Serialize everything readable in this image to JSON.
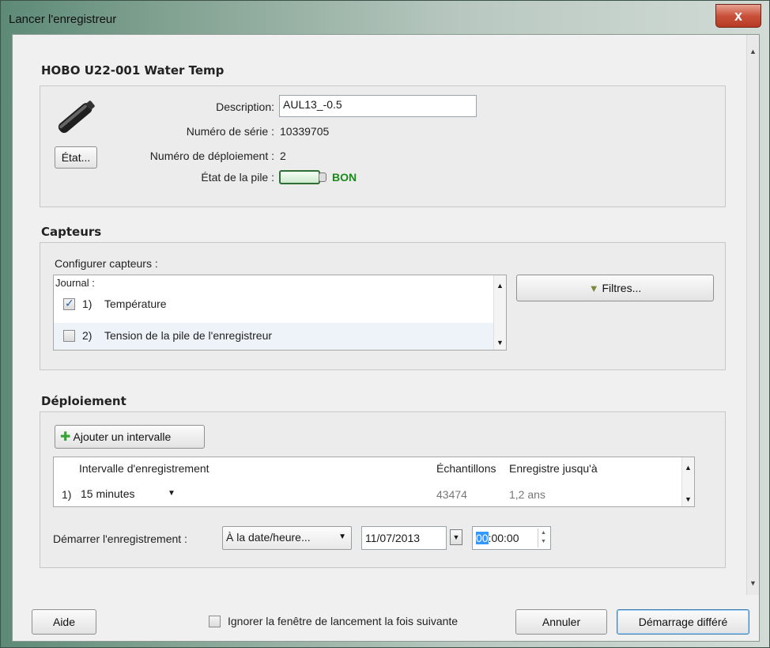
{
  "window": {
    "title": "Lancer l'enregistreur",
    "close_label": "x"
  },
  "device": {
    "section_title": "HOBO U22-001 Water Temp",
    "description_label": "Description:",
    "description_value": "AUL13_-0.5",
    "serial_label": "Numéro de série :",
    "serial_value": "10339705",
    "deployment_label": "Numéro de déploiement :",
    "deployment_value": "2",
    "battery_label": "État de la pile :",
    "battery_status": "BON",
    "status_button": "État..."
  },
  "sensors": {
    "section_title": "Capteurs",
    "configure_label": "Configurer capteurs :",
    "journal_label": "Journal :",
    "items": [
      {
        "index": "1)",
        "label": "Température",
        "checked": true
      },
      {
        "index": "2)",
        "label": "Tension de la pile de l'enregistreur",
        "checked": false
      }
    ],
    "filters_button": "Filtres..."
  },
  "deployment": {
    "section_title": "Déploiement",
    "add_interval_button": "Ajouter un intervalle",
    "columns": [
      "Intervalle d'enregistrement",
      "Échantillons",
      "Enregistre jusqu'à"
    ],
    "rows": [
      {
        "index": "1)",
        "interval": "15 minutes",
        "samples": "43474",
        "until": "1,2 ans"
      }
    ],
    "start_label": "Démarrer l'enregistrement :",
    "start_mode": "À la date/heure...",
    "start_date": "11/07/2013",
    "start_time_hour": "00",
    "start_time_rest": ":00:00"
  },
  "footer": {
    "help_button": "Aide",
    "ignore_checkbox_label": "Ignorer la fenêtre de lancement la fois suivante",
    "cancel_button": "Annuler",
    "start_button": "Démarrage différé"
  },
  "icons": {
    "close": "close-icon",
    "probe": "temperature-probe-icon",
    "filter": "filter-icon",
    "add": "plus-icon"
  }
}
